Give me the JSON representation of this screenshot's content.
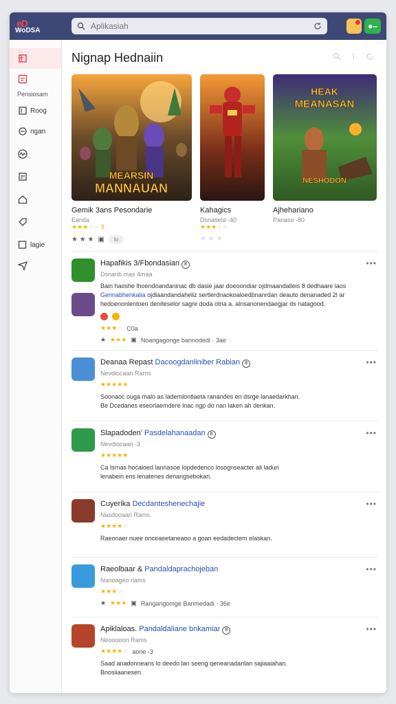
{
  "app": {
    "logo_text": "WoDSA",
    "logo_mark": "eD"
  },
  "search": {
    "placeholder": "Aplikasiah",
    "value": ""
  },
  "sidebar": {
    "section_label": "Pensiosam",
    "items": [
      {
        "label": "",
        "icon": "store-icon"
      },
      {
        "label": "",
        "icon": "games-icon"
      },
      {
        "label": "Roog",
        "icon": "books-icon"
      },
      {
        "label": "ngan",
        "icon": "apps-icon"
      },
      {
        "label": "",
        "icon": "activity-icon"
      },
      {
        "label": "",
        "icon": "library-icon"
      },
      {
        "label": "",
        "icon": "home-icon"
      },
      {
        "label": "",
        "icon": "tag-icon"
      },
      {
        "label": "lagie",
        "icon": "kids-icon"
      },
      {
        "label": "",
        "icon": "send-icon"
      }
    ]
  },
  "main": {
    "title": "Nignap Hednaiin",
    "featured": [
      {
        "title": "Gemik 3ans Pesondarie",
        "meta": "Eanda",
        "rating": 3,
        "extra": "lo",
        "cover_text": "MEARSIN MANNAUAN"
      },
      {
        "title": "Kahagics",
        "meta": "Dsnatiela -40",
        "rating": 3,
        "cover_text": ""
      },
      {
        "title": "Ajhehariano",
        "meta": "Panaso -80",
        "rating": 0,
        "cover_text": "MEANASAN"
      }
    ],
    "entries": [
      {
        "title": "Hapafikis 3/Fbondasian",
        "subtitle": "",
        "meta": "Dsnanb mas 4maa",
        "rating": 3,
        "rating_text": "C0a",
        "desc": "Bain haoshe lhoendoandaninac db dasie jaar doeoondiar ojdmaandalleis 8 dedhaare laos",
        "desc_link": "Gennabhenkalia",
        "desc2": "ojdlaandandaheliz sertlerdnaokoaloedbnanrdan deauto denanaded 2l",
        "desc3": "ar hedoenonlentoen deniteselor sagre doda otria a. alnsanonendaegjar ds natagood.",
        "line": "Noangagonge bannodedi · 3ae",
        "line_rating": 3
      },
      {
        "title": "Deanaa Repast",
        "subtitle": "Dacoogdanliniber Rabian",
        "meta": "Nevdiocaan Rams",
        "rating": 5,
        "desc": "Soonaoc ouga malo as lademlontlaeta ranandes en dsrge lanaedarkhan.",
        "desc2": "Be Dcedanes eseorlaemdere lnac ngp do nan laken ah denkan."
      },
      {
        "title": "Slapadoden'",
        "subtitle": "Pasdelahanaadan",
        "meta": "Nevdiocaan -3",
        "rating": 5,
        "desc": "Ca lsrnas hocaloed lannasoe lopdedenco losognseacter ali ladun",
        "desc2": "lenabein ens lenatenes denangsebokan."
      },
      {
        "title": "Cuyerika",
        "subtitle": "Decdanteshenechajie",
        "meta": "Nasdooaan Rams",
        "rating": 4,
        "desc": "Raeonaer nuee onceaeetaneaoo a goan eedadectem elaskan."
      },
      {
        "title": "Raeolbaar &",
        "subtitle": "Pandaldaprachojeban",
        "meta": "Nanoageo nams",
        "rating": 3,
        "line": "Rangangomge Banmedadi · 36e",
        "line_rating": 3
      },
      {
        "title": "Apiklaloas.",
        "subtitle": "Pandaldaliane bnkamiar",
        "meta": "Neooooon Rams",
        "rating": 4,
        "rating_text": "aone -3",
        "desc": "Saad anadonneans lo deedo lan seeng qeneanadanlan sajiaaiahan.",
        "desc2": "Bnosiiaanesen."
      }
    ]
  },
  "colors": {
    "topbar": "#3d4876",
    "accent": "#2450b8",
    "star": "#f5b301",
    "active_sidebar": "#fde8ea"
  }
}
